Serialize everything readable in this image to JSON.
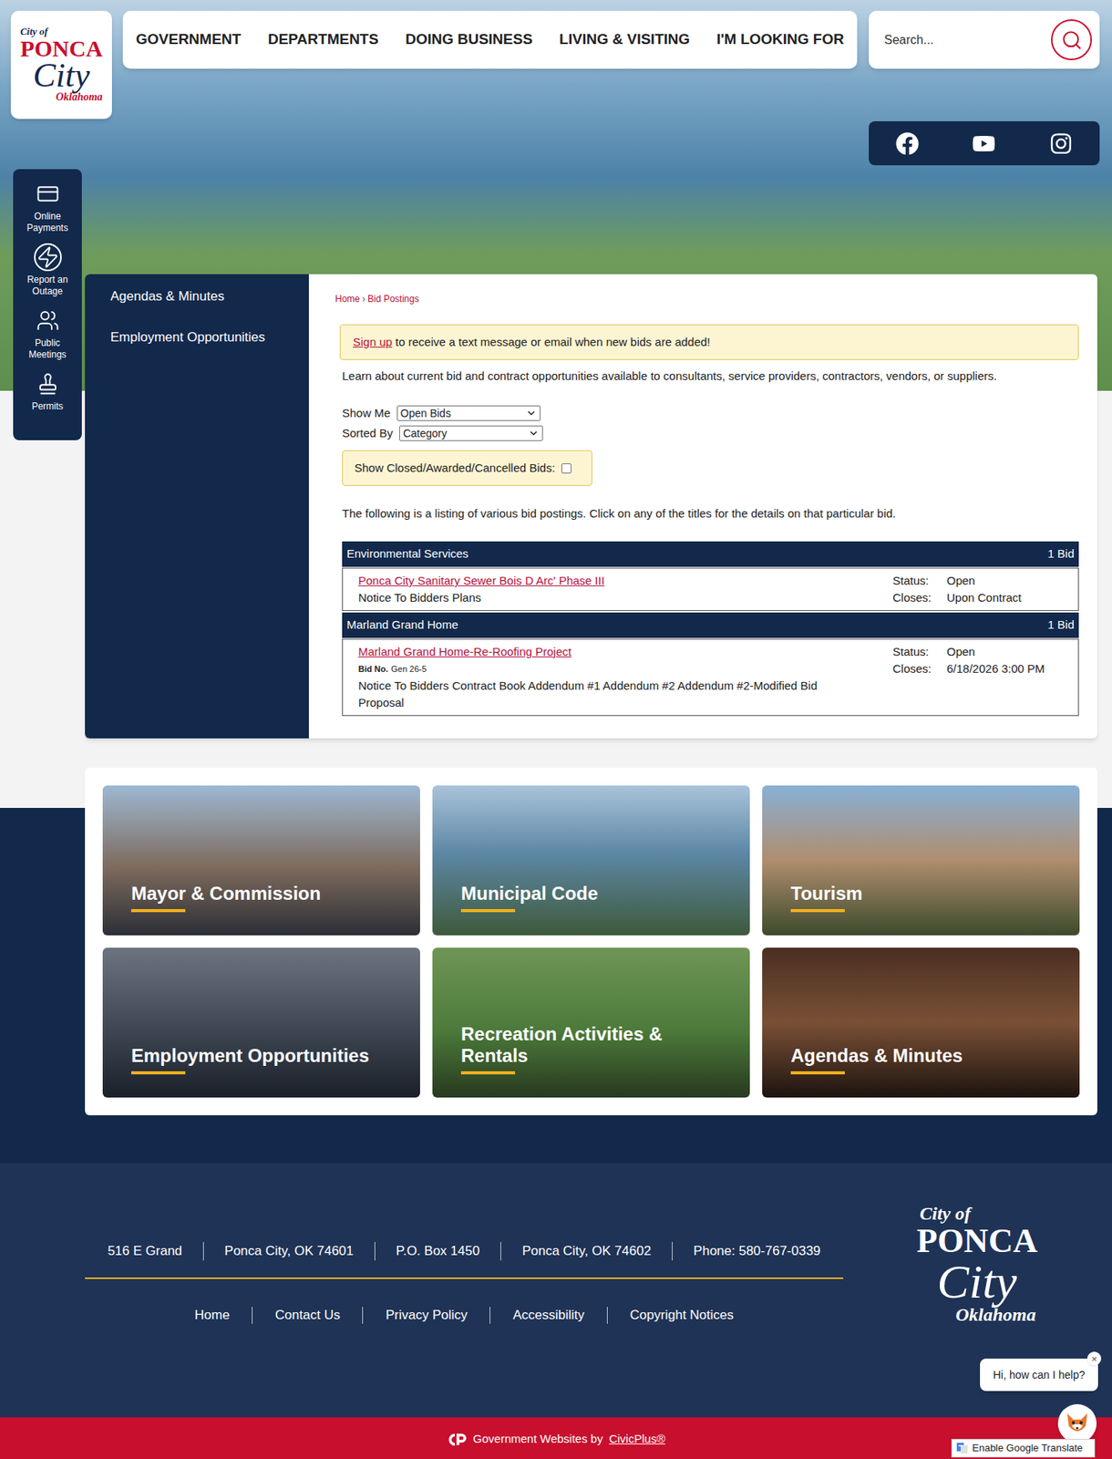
{
  "logo": {
    "line1": "City of",
    "line2": "PONCA",
    "line3": "City",
    "line4": "Oklahoma"
  },
  "nav": [
    "GOVERNMENT",
    "DEPARTMENTS",
    "DOING BUSINESS",
    "LIVING & VISITING",
    "I'M LOOKING FOR"
  ],
  "search": {
    "placeholder": "Search..."
  },
  "quick_links": [
    "Online Payments",
    "Report an Outage",
    "Public Meetings",
    "Permits"
  ],
  "sidebar": {
    "items": [
      "Agendas & Minutes",
      "Employment Opportunities"
    ]
  },
  "breadcrumb": {
    "home": "Home",
    "separator": "›",
    "current": "Bid Postings"
  },
  "alert": {
    "link": "Sign up",
    "text": " to receive a text message or email when new bids are added!"
  },
  "intro": "Learn about current bid and contract opportunities available to consultants, service providers, contractors, vendors, or suppliers.",
  "filters": [
    {
      "label": "Show Me",
      "value": "Open Bids"
    },
    {
      "label": "Sorted By",
      "value": "Category"
    }
  ],
  "checkbox": {
    "label": "Show Closed/Awarded/Cancelled Bids:",
    "checked": false
  },
  "listing_note": "The following is a listing of various bid postings. Click on any of the titles for the details on that particular bid.",
  "categories": [
    {
      "name": "Environmental Services",
      "count": "1 Bid",
      "bids": [
        {
          "title": "Ponca City Sanitary Sewer Bois D Arc' Phase III",
          "bid_no_label": "",
          "bid_no": "",
          "documents": "Notice To Bidders Plans",
          "status_label": "Status:",
          "status": "Open",
          "closes_label": "Closes:",
          "closes": "Upon Contract"
        }
      ]
    },
    {
      "name": "Marland Grand Home",
      "count": "1 Bid",
      "bids": [
        {
          "title": "Marland Grand Home-Re-Roofing Project",
          "bid_no_label": "Bid No.",
          "bid_no": "Gen 26-5",
          "documents": "Notice To Bidders Contract Book Addendum #1 Addendum #2 Addendum #2-Modified Bid Proposal",
          "status_label": "Status:",
          "status": "Open",
          "closes_label": "Closes:",
          "closes": "6/18/2026 3:00 PM"
        }
      ]
    }
  ],
  "tiles": [
    "Mayor & Commission",
    "Municipal Code",
    "Tourism",
    "Employment Opportunities",
    "Recreation Activities & Rentals",
    "Agendas & Minutes"
  ],
  "footer": {
    "address": [
      "516 E Grand",
      "Ponca City, OK 74601",
      "P.O. Box 1450",
      "Ponca City, OK 74602",
      "Phone: 580-767-0339"
    ],
    "links": [
      "Home",
      "Contact Us",
      "Privacy Policy",
      "Accessibility",
      "Copyright Notices"
    ]
  },
  "credit": {
    "text": "Government Websites by",
    "link": "CivicPlus®"
  },
  "chat": {
    "message": "Hi, how can I help?",
    "close": "×"
  },
  "translate": {
    "label": "Enable Google Translate"
  }
}
